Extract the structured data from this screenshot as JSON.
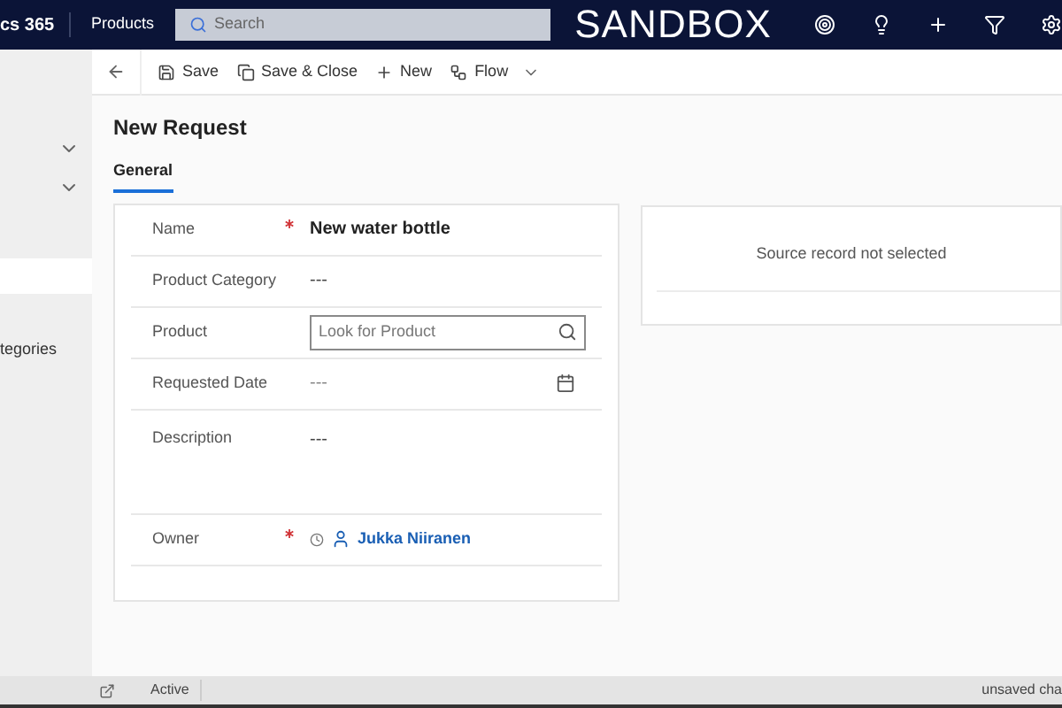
{
  "top_bar": {
    "app_name": "cs 365",
    "area": "Products",
    "search_placeholder": "Search",
    "environment": "SANDBOX"
  },
  "command_bar": [
    {
      "kind": "save",
      "label": "Save"
    },
    {
      "kind": "save_close",
      "label": "Save & Close"
    },
    {
      "kind": "new",
      "label": "New"
    },
    {
      "kind": "flow",
      "label": "Flow"
    }
  ],
  "sidebar": {
    "items": [
      {
        "label": "tegories"
      }
    ]
  },
  "form": {
    "title": "New Request",
    "tabs": [
      {
        "label": "General",
        "selected": true
      }
    ],
    "fields": [
      {
        "kind": "text",
        "label": "Name",
        "required": true,
        "value": "New water bottle"
      },
      {
        "kind": "text",
        "label": "Product Category",
        "required": false,
        "value": "---"
      },
      {
        "kind": "lookup",
        "label": "Product",
        "required": false,
        "placeholder": "Look for Product"
      },
      {
        "kind": "date",
        "label": "Requested Date",
        "required": false,
        "placeholder": "---"
      },
      {
        "kind": "multiline",
        "label": "Description",
        "required": false,
        "value": "---"
      },
      {
        "kind": "owner",
        "label": "Owner",
        "required": true,
        "value": "Jukka Niiranen"
      }
    ]
  },
  "side_panel": {
    "message": "Source record not selected"
  },
  "status_bar": {
    "status": "Active",
    "save_state": "unsaved cha"
  }
}
